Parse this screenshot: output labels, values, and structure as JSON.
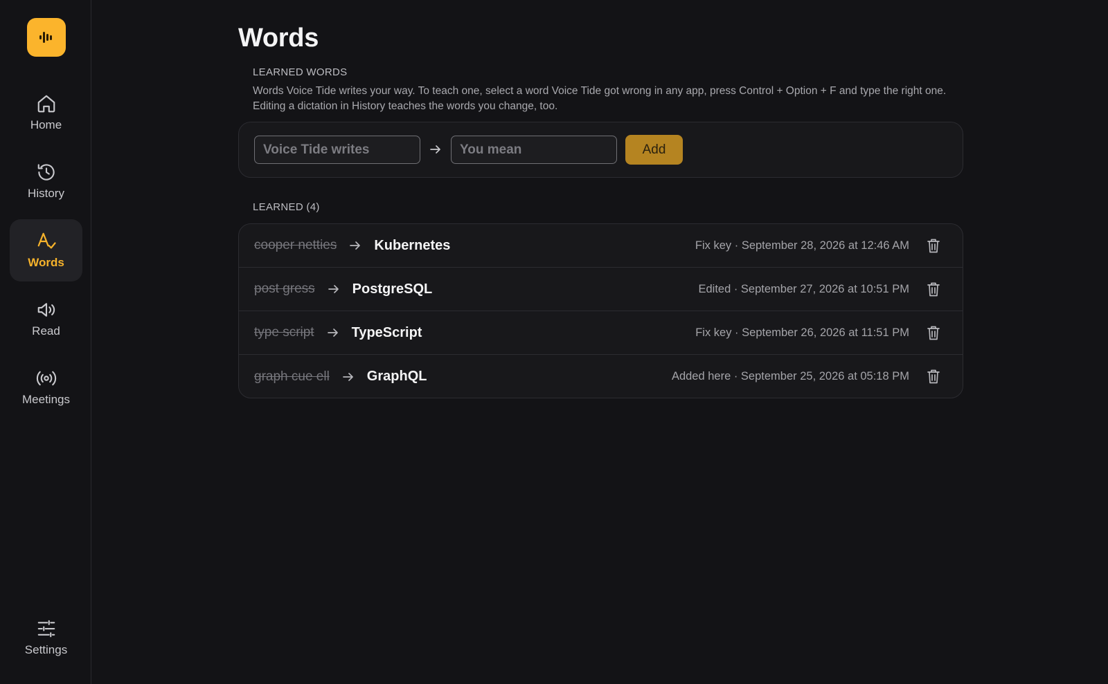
{
  "sidebar": {
    "logo_icon": "waveform-icon",
    "items": [
      {
        "label": "Home",
        "icon": "home-icon"
      },
      {
        "label": "History",
        "icon": "history-icon"
      },
      {
        "label": "Words",
        "icon": "spellcheck-icon",
        "active": true
      },
      {
        "label": "Read",
        "icon": "speaker-icon"
      },
      {
        "label": "Meetings",
        "icon": "broadcast-icon"
      }
    ],
    "settings": {
      "label": "Settings",
      "icon": "sliders-icon"
    }
  },
  "page": {
    "title": "Words"
  },
  "learned_words": {
    "heading": "LEARNED WORDS",
    "description": "Words Voice Tide writes your way. To teach one, select a word Voice Tide got wrong in any app, press Control + Option + F and type the right one. Editing a dictation in History teaches the words you change, too.",
    "form": {
      "wrong_placeholder": "Voice Tide writes",
      "wrong_value": "",
      "right_placeholder": "You mean",
      "right_value": "",
      "add_label": "Add"
    }
  },
  "learned": {
    "heading": "LEARNED (4)",
    "items": [
      {
        "wrong": "cooper netties",
        "right": "Kubernetes",
        "meta": "Fix key · September 28, 2026 at 12:46 AM"
      },
      {
        "wrong": "post gress",
        "right": "PostgreSQL",
        "meta": "Edited · September 27, 2026 at 10:51 PM"
      },
      {
        "wrong": "type script",
        "right": "TypeScript",
        "meta": "Fix key · September 26, 2026 at 11:51 PM"
      },
      {
        "wrong": "graph cue ell",
        "right": "GraphQL",
        "meta": "Added here · September 25, 2026 at 05:18 PM"
      }
    ]
  },
  "colors": {
    "accent": "#fbb42c",
    "background": "#131316",
    "card": "#18181b",
    "add_button": "#b58421"
  }
}
